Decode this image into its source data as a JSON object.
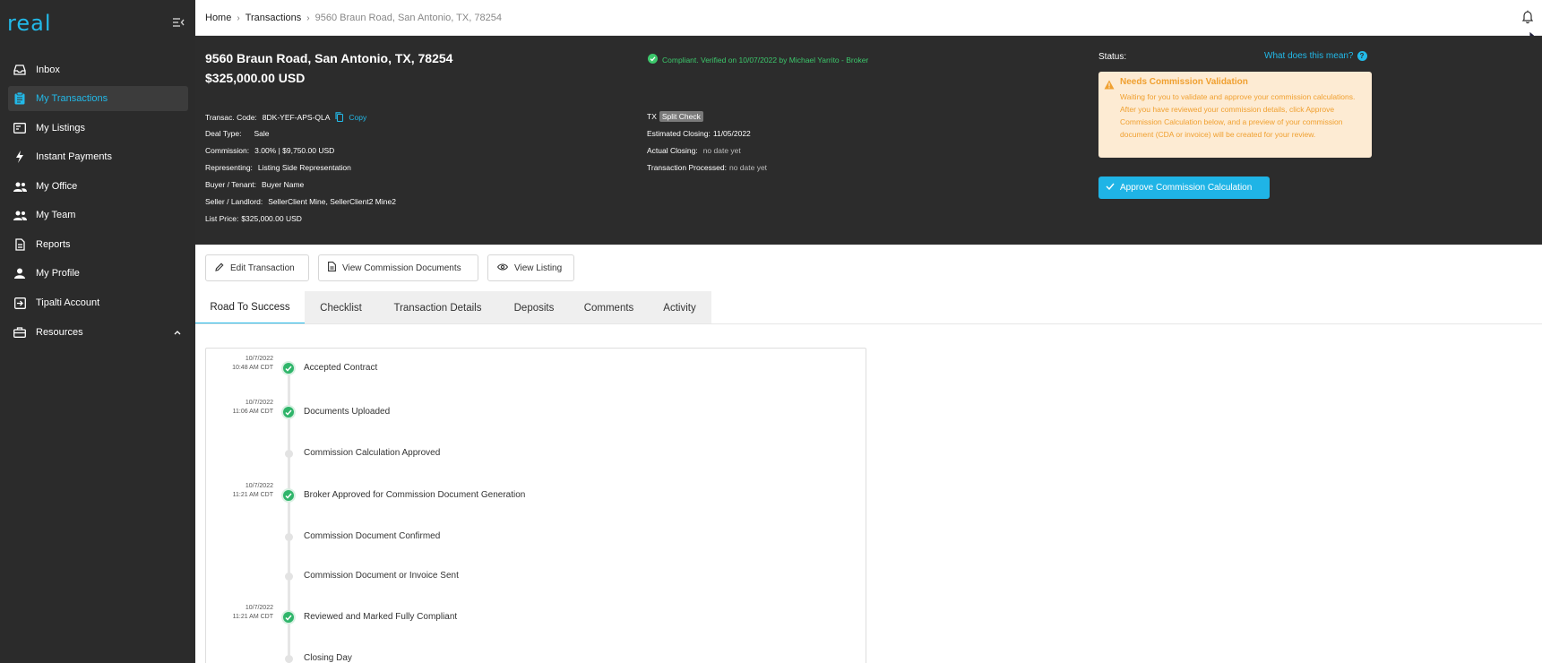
{
  "brand": {
    "logo_text": "real",
    "accent": "#22b9e8"
  },
  "sidebar": {
    "items": [
      {
        "label": "Inbox",
        "icon": "inbox-icon"
      },
      {
        "label": "My Transactions",
        "icon": "clipboard-icon",
        "active": true
      },
      {
        "label": "My Listings",
        "icon": "listing-icon"
      },
      {
        "label": "Instant Payments",
        "icon": "lightning-icon"
      },
      {
        "label": "My Office",
        "icon": "people-icon"
      },
      {
        "label": "My Team",
        "icon": "team-icon"
      },
      {
        "label": "Reports",
        "icon": "report-icon"
      },
      {
        "label": "My Profile",
        "icon": "person-icon"
      },
      {
        "label": "Tipalti Account",
        "icon": "login-icon"
      },
      {
        "label": "Resources",
        "icon": "briefcase-icon"
      }
    ]
  },
  "breadcrumb": {
    "home": "Home",
    "transactions": "Transactions",
    "current": "9560 Braun Road, San Antonio, TX, 78254"
  },
  "header": {
    "address": "9560 Braun Road, San Antonio, TX, 78254",
    "price": "$325,000.00 USD",
    "compliance": "Compliant. Verified on 10/07/2022 by Michael Yarrito - Broker",
    "left_details": {
      "code_label": "Transac. Code:",
      "code_value": "8DK-YEF-APS-QLA",
      "copy": "Copy",
      "deal_label": "Deal Type:",
      "deal_value": "Sale",
      "commission_label": "Commission:",
      "commission_value": "3.00% | $9,750.00 USD",
      "representing_label": "Representing:",
      "representing_value": "Listing Side Representation",
      "buyer_label": "Buyer / Tenant:",
      "buyer_value": "Buyer Name",
      "seller_label": "Seller / Landlord:",
      "seller_value": "SellerClient Mine, SellerClient2 Mine2",
      "list_label": "List Price:",
      "list_value": "$325,000.00 USD"
    },
    "mid_details": {
      "state": "TX",
      "tag": "Split Check",
      "est_label": "Estimated Closing:",
      "est_value": "11/05/2022",
      "actual_label": "Actual Closing:",
      "actual_value": "no date yet",
      "processed_label": "Transaction Processed:",
      "processed_value": "no date yet"
    },
    "status": {
      "label": "Status:",
      "help_link": "What does this mean?",
      "notice_title": "Needs Commission Validation",
      "notice_body": "Waiting for you to validate and approve your commission calculations. After you have reviewed your commission details, click Approve Commission Calculation below, and a preview of your commission document (CDA or invoice) will be created for your review.",
      "approve_button": "Approve Commission Calculation"
    }
  },
  "actions": {
    "edit": "Edit Transaction",
    "view_docs": "View Commission Documents",
    "view_listing": "View Listing"
  },
  "tabs": [
    "Road To Success",
    "Checklist",
    "Transaction Details",
    "Deposits",
    "Comments",
    "Activity"
  ],
  "timeline": [
    {
      "date": "10/7/2022",
      "time": "10:48 AM CDT",
      "label": "Accepted Contract",
      "done": true
    },
    {
      "date": "10/7/2022",
      "time": "11:06 AM CDT",
      "label": "Documents Uploaded",
      "done": true
    },
    {
      "date": "",
      "time": "",
      "label": "Commission Calculation Approved",
      "done": false
    },
    {
      "date": "10/7/2022",
      "time": "11:21 AM CDT",
      "label": "Broker Approved for Commission Document Generation",
      "done": true
    },
    {
      "date": "",
      "time": "",
      "label": "Commission Document Confirmed",
      "done": false
    },
    {
      "date": "",
      "time": "",
      "label": "Commission Document or Invoice Sent",
      "done": false
    },
    {
      "date": "10/7/2022",
      "time": "11:21 AM CDT",
      "label": "Reviewed and Marked Fully Compliant",
      "done": true
    },
    {
      "date": "",
      "time": "",
      "label": "Closing Day",
      "done": false
    }
  ]
}
